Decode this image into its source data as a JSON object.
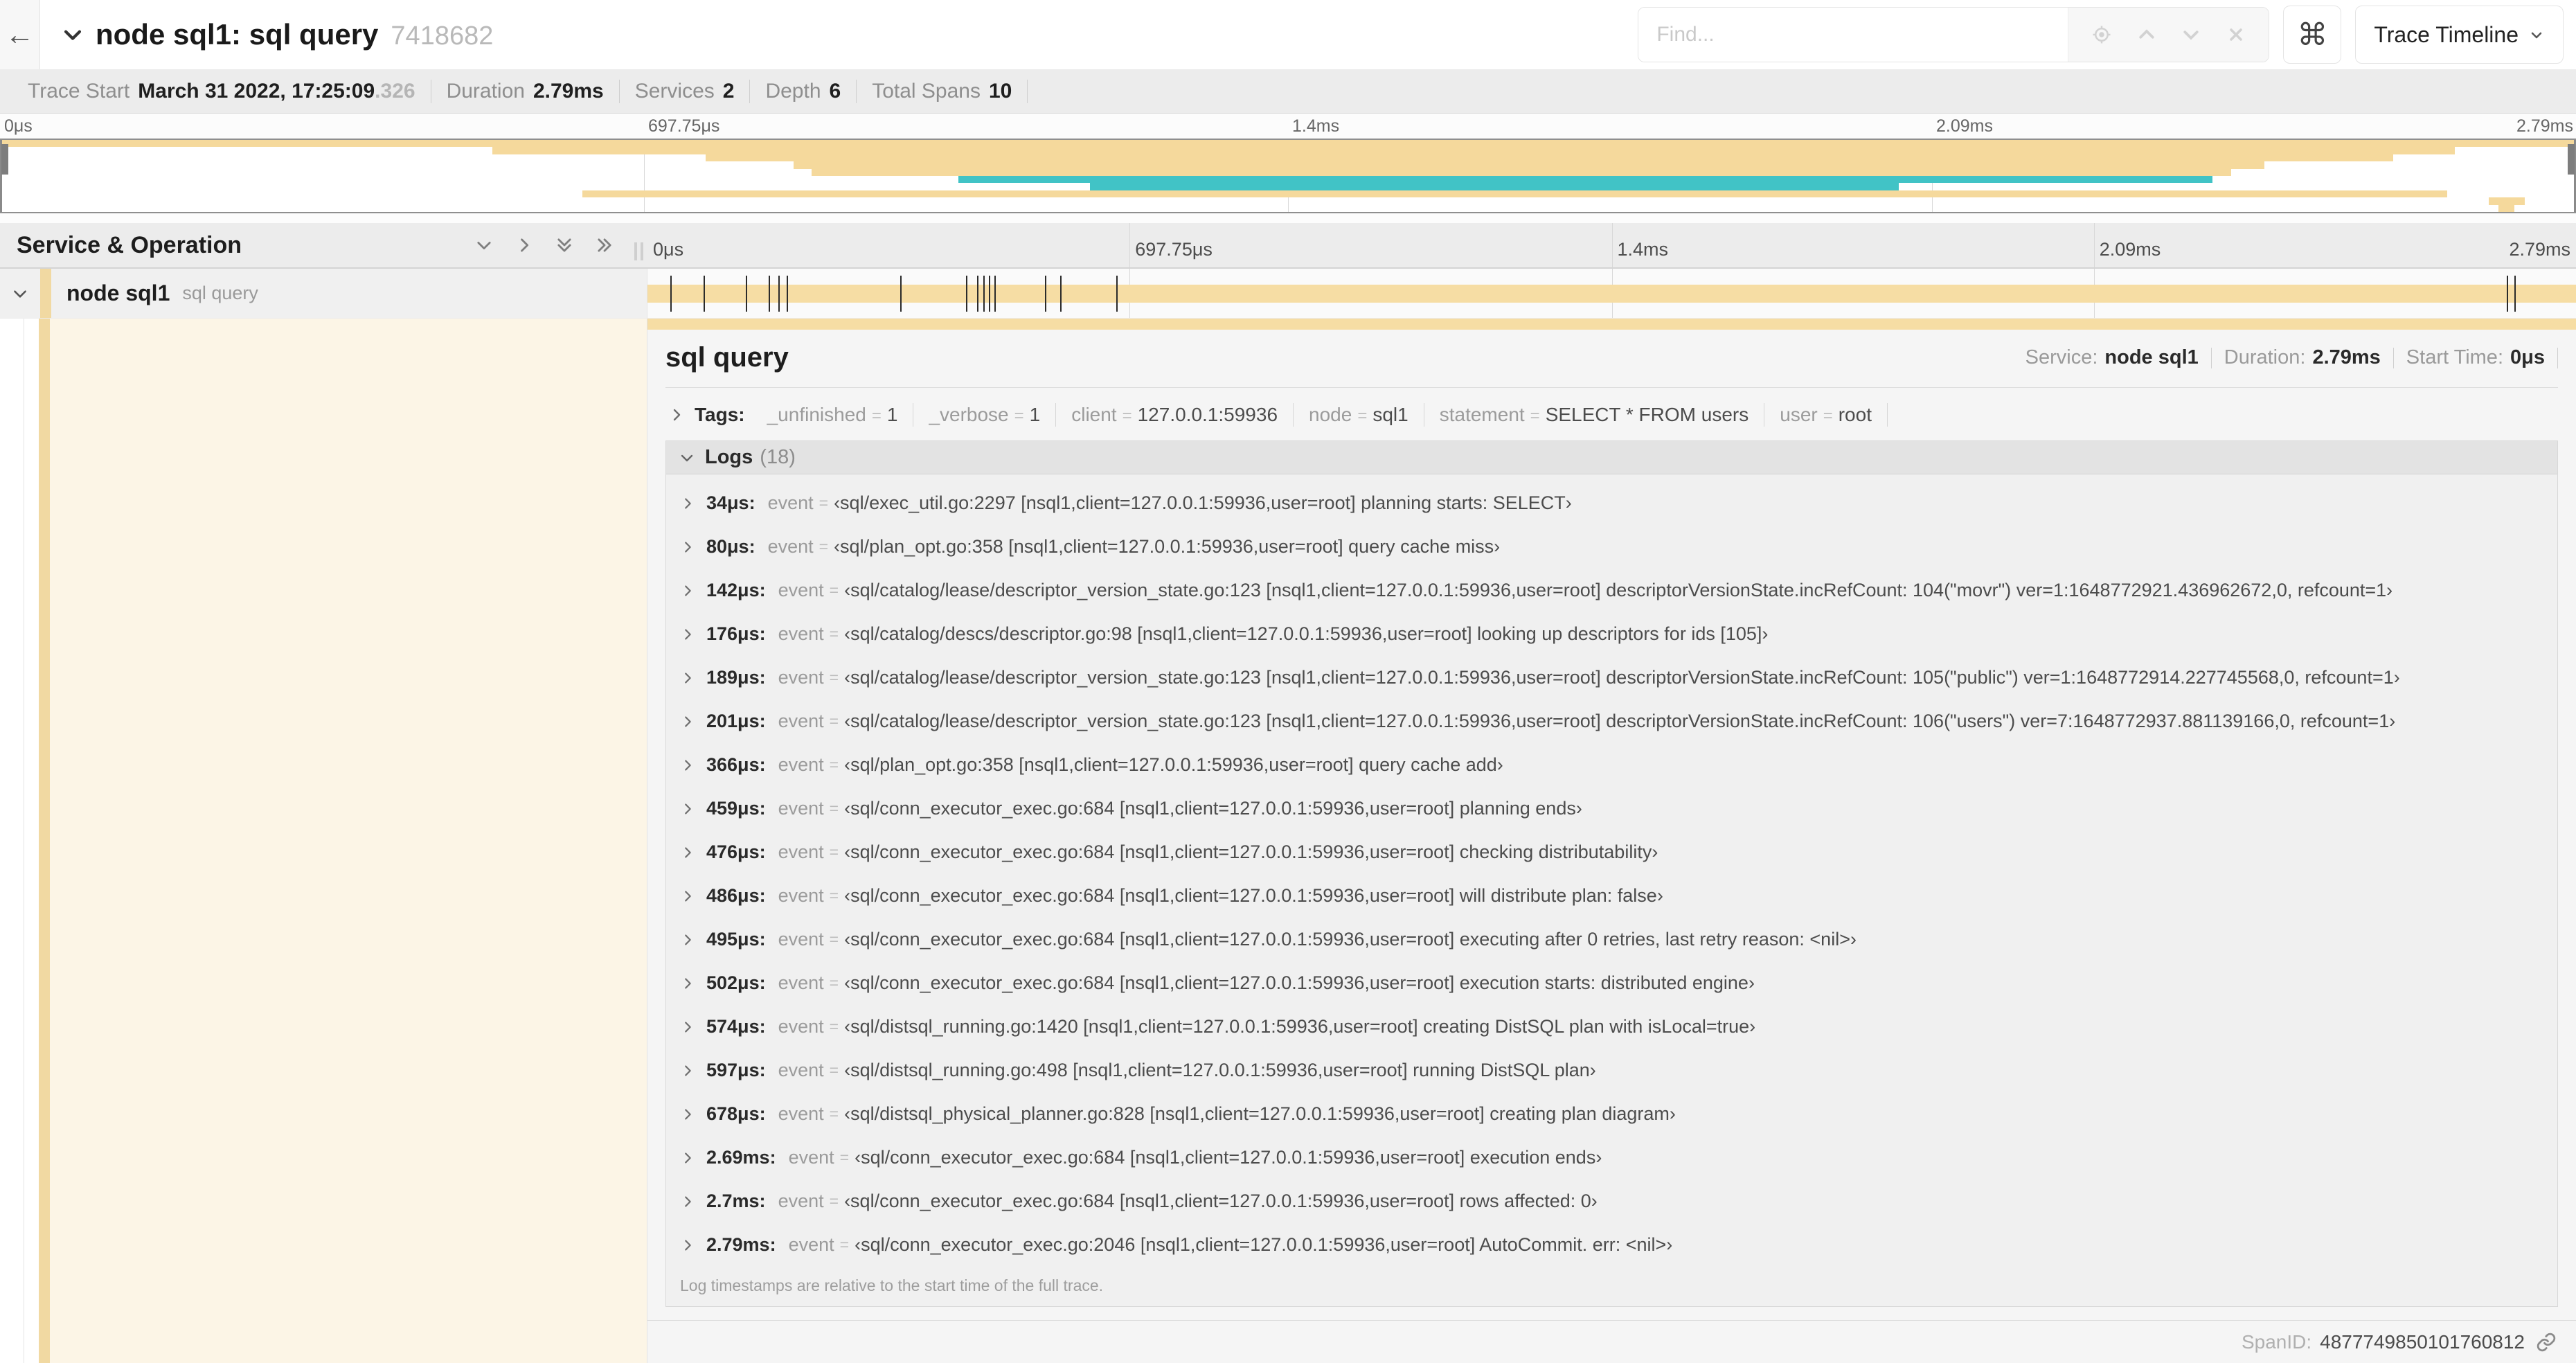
{
  "header": {
    "title": "node sql1: sql query",
    "trace_id": "7418682",
    "back_arrow": "←",
    "find_placeholder": "Find...",
    "shortcut_key": "⌘",
    "view_selector": "Trace Timeline"
  },
  "trace_info": [
    {
      "label": "Trace Start",
      "value": "March 31 2022, 17:25:09",
      "extra": ".326"
    },
    {
      "label": "Duration",
      "value": "2.79ms"
    },
    {
      "label": "Services",
      "value": "2"
    },
    {
      "label": "Depth",
      "value": "6"
    },
    {
      "label": "Total Spans",
      "value": "10"
    }
  ],
  "colors": {
    "span_tan": "#f5d99c",
    "span_teal": "#41c3c6",
    "accent_stripe": "#f1d9a2"
  },
  "minimap": {
    "spans": [
      {
        "s": 0,
        "w": 100,
        "c": "#f5d99c"
      },
      {
        "s": 19.1,
        "w": 76.2,
        "c": "#f5d99c"
      },
      {
        "s": 27.4,
        "w": 65.5,
        "c": "#f5d99c"
      },
      {
        "s": 30.8,
        "w": 57.1,
        "c": "#f5d99c"
      },
      {
        "s": 31.5,
        "w": 55.1,
        "c": "#f5d99c"
      },
      {
        "s": 37.2,
        "w": 48.7,
        "c": "#41c3c6"
      },
      {
        "s": 42.3,
        "w": 31.4,
        "c": "#41c3c6"
      },
      {
        "s": 22.6,
        "w": 72.4,
        "c": "#f5d99c"
      },
      {
        "s": 96.6,
        "w": 1.4,
        "c": "#f5d99c"
      },
      {
        "s": 97.0,
        "w": 0.6,
        "c": "#f5d99c"
      }
    ]
  },
  "timeline": {
    "left_header": "Service & Operation",
    "ticks": [
      {
        "label": "0μs",
        "pct": 0
      },
      {
        "label": "697.75μs",
        "pct": 25
      },
      {
        "label": "1.4ms",
        "pct": 50
      },
      {
        "label": "2.09ms",
        "pct": 75
      },
      {
        "label": "2.79ms",
        "pct": 100
      }
    ]
  },
  "span_row": {
    "service": "node sql1",
    "operation": "sql query",
    "log_marks": [
      1.2,
      2.9,
      5.1,
      6.3,
      6.8,
      7.2,
      13.1,
      16.5,
      17.1,
      17.4,
      17.7,
      18.0,
      20.6,
      21.4,
      24.3,
      96.4,
      96.8,
      100
    ]
  },
  "detail": {
    "title": "sql query",
    "meta": [
      {
        "label": "Service:",
        "value": "node sql1"
      },
      {
        "label": "Duration:",
        "value": "2.79ms"
      },
      {
        "label": "Start Time:",
        "value": "0μs"
      }
    ],
    "tags_label": "Tags:",
    "tags": [
      {
        "k": "_unfinished",
        "v": "1"
      },
      {
        "k": "_verbose",
        "v": "1"
      },
      {
        "k": "client",
        "v": "127.0.0.1:59936"
      },
      {
        "k": "node",
        "v": "sql1"
      },
      {
        "k": "statement",
        "v": "SELECT * FROM users"
      },
      {
        "k": "user",
        "v": "root"
      }
    ],
    "logs_label": "Logs",
    "logs_count": "(18)",
    "log_field": "event",
    "logs": [
      {
        "t": "34μs:",
        "f": "event",
        "v": "‹sql/exec_util.go:2297 [nsql1,client=127.0.0.1:59936,user=root] planning starts: SELECT›"
      },
      {
        "t": "80μs:",
        "f": "event",
        "v": "‹sql/plan_opt.go:358 [nsql1,client=127.0.0.1:59936,user=root] query cache miss›"
      },
      {
        "t": "142μs:",
        "f": "event",
        "v": "‹sql/catalog/lease/descriptor_version_state.go:123 [nsql1,client=127.0.0.1:59936,user=root] descriptorVersionState.incRefCount: 104(\"movr\") ver=1:1648772921.436962672,0, refcount=1›"
      },
      {
        "t": "176μs:",
        "f": "event",
        "v": "‹sql/catalog/descs/descriptor.go:98 [nsql1,client=127.0.0.1:59936,user=root] looking up descriptors for ids [105]›"
      },
      {
        "t": "189μs:",
        "f": "event",
        "v": "‹sql/catalog/lease/descriptor_version_state.go:123 [nsql1,client=127.0.0.1:59936,user=root] descriptorVersionState.incRefCount: 105(\"public\") ver=1:1648772914.227745568,0, refcount=1›"
      },
      {
        "t": "201μs:",
        "f": "event",
        "v": "‹sql/catalog/lease/descriptor_version_state.go:123 [nsql1,client=127.0.0.1:59936,user=root] descriptorVersionState.incRefCount: 106(\"users\") ver=7:1648772937.881139166,0, refcount=1›"
      },
      {
        "t": "366μs:",
        "f": "event",
        "v": "‹sql/plan_opt.go:358 [nsql1,client=127.0.0.1:59936,user=root] query cache add›"
      },
      {
        "t": "459μs:",
        "f": "event",
        "v": "‹sql/conn_executor_exec.go:684 [nsql1,client=127.0.0.1:59936,user=root] planning ends›"
      },
      {
        "t": "476μs:",
        "f": "event",
        "v": "‹sql/conn_executor_exec.go:684 [nsql1,client=127.0.0.1:59936,user=root] checking distributability›"
      },
      {
        "t": "486μs:",
        "f": "event",
        "v": "‹sql/conn_executor_exec.go:684 [nsql1,client=127.0.0.1:59936,user=root] will distribute plan: false›"
      },
      {
        "t": "495μs:",
        "f": "event",
        "v": "‹sql/conn_executor_exec.go:684 [nsql1,client=127.0.0.1:59936,user=root] executing after 0 retries, last retry reason: <nil>›"
      },
      {
        "t": "502μs:",
        "f": "event",
        "v": "‹sql/conn_executor_exec.go:684 [nsql1,client=127.0.0.1:59936,user=root] execution starts: distributed engine›"
      },
      {
        "t": "574μs:",
        "f": "event",
        "v": "‹sql/distsql_running.go:1420 [nsql1,client=127.0.0.1:59936,user=root] creating DistSQL plan with isLocal=true›"
      },
      {
        "t": "597μs:",
        "f": "event",
        "v": "‹sql/distsql_running.go:498 [nsql1,client=127.0.0.1:59936,user=root] running DistSQL plan›"
      },
      {
        "t": "678μs:",
        "f": "event",
        "v": "‹sql/distsql_physical_planner.go:828 [nsql1,client=127.0.0.1:59936,user=root] creating plan diagram›"
      },
      {
        "t": "2.69ms:",
        "f": "event",
        "v": "‹sql/conn_executor_exec.go:684 [nsql1,client=127.0.0.1:59936,user=root] execution ends›"
      },
      {
        "t": "2.7ms:",
        "f": "event",
        "v": "‹sql/conn_executor_exec.go:684 [nsql1,client=127.0.0.1:59936,user=root] rows affected: 0›"
      },
      {
        "t": "2.79ms:",
        "f": "event",
        "v": "‹sql/conn_executor_exec.go:2046 [nsql1,client=127.0.0.1:59936,user=root] AutoCommit. err: <nil>›"
      }
    ],
    "footnote": "Log timestamps are relative to the start time of the full trace.",
    "span_id_label": "SpanID:",
    "span_id": "4877749850101760812"
  }
}
